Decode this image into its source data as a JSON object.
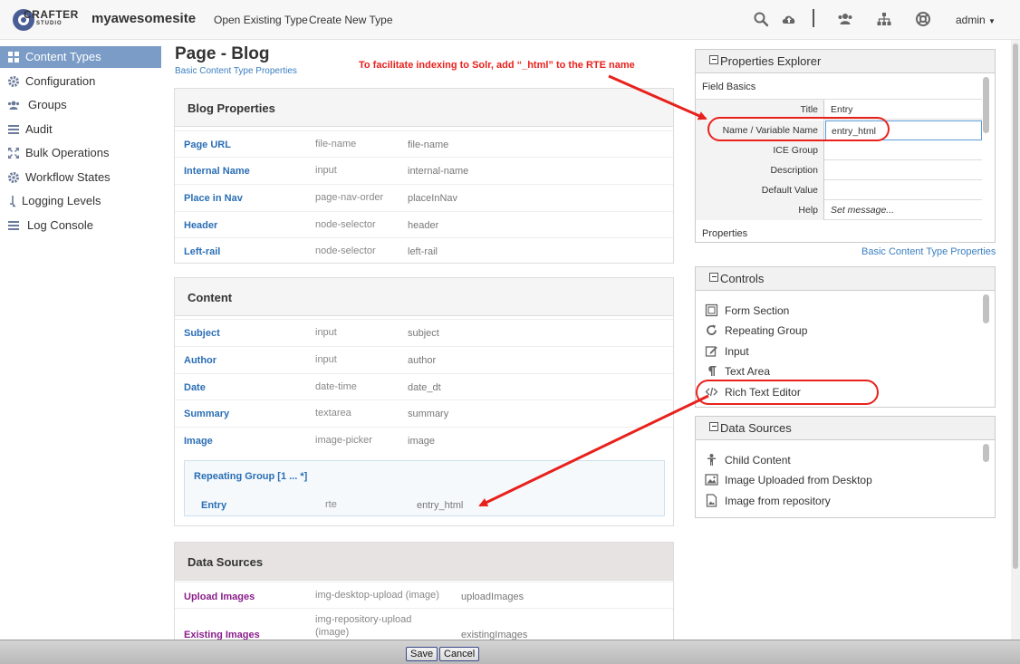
{
  "header": {
    "logo_text": "CRAFTER",
    "logo_sub": "STUDIO",
    "site_name": "myawesomesite",
    "nav": [
      "Open Existing Type",
      "Create New Type"
    ],
    "user": "admin"
  },
  "sidebar": {
    "items": [
      {
        "label": "Content Types",
        "icon": "grid-icon",
        "active": true
      },
      {
        "label": "Configuration",
        "icon": "gear-icon"
      },
      {
        "label": "Groups",
        "icon": "users-icon"
      },
      {
        "label": "Audit",
        "icon": "list-icon"
      },
      {
        "label": "Bulk Operations",
        "icon": "expand-icon"
      },
      {
        "label": "Workflow States",
        "icon": "gear-icon"
      },
      {
        "label": "Logging Levels",
        "icon": "level-icon"
      },
      {
        "label": "Log Console",
        "icon": "list-icon"
      }
    ]
  },
  "form": {
    "title": "Page - Blog",
    "subtitle": "Basic Content Type Properties",
    "annotation": "To facilitate indexing to Solr, add “_html” to the RTE name",
    "sections": [
      {
        "title": "Blog Properties",
        "rows": [
          {
            "label": "Page URL",
            "type": "file-name",
            "id": "file-name"
          },
          {
            "label": "Internal Name",
            "type": "input",
            "id": "internal-name"
          },
          {
            "label": "Place in Nav",
            "type": "page-nav-order",
            "id": "placeInNav"
          },
          {
            "label": "Header",
            "type": "node-selector",
            "id": "header"
          },
          {
            "label": "Left-rail",
            "type": "node-selector",
            "id": "left-rail"
          }
        ]
      },
      {
        "title": "Content",
        "rows": [
          {
            "label": "Subject",
            "type": "input",
            "id": "subject"
          },
          {
            "label": "Author",
            "type": "input",
            "id": "author"
          },
          {
            "label": "Date",
            "type": "date-time",
            "id": "date_dt"
          },
          {
            "label": "Summary",
            "type": "textarea",
            "id": "summary"
          },
          {
            "label": "Image",
            "type": "image-picker",
            "id": "image"
          }
        ],
        "repeating_group": {
          "title": "Repeating Group [1 ... *]",
          "rows": [
            {
              "label": "Entry",
              "type": "rte",
              "id": "entry_html"
            }
          ]
        }
      },
      {
        "title": "Data Sources",
        "rows": [
          {
            "label": "Upload Images",
            "type": "img-desktop-upload (image)",
            "id": "uploadImages"
          },
          {
            "label": "Existing Images",
            "type": "img-repository-upload (image)",
            "id": "existingImages"
          }
        ]
      }
    ]
  },
  "properties_explorer": {
    "title": "Properties Explorer",
    "group": "Field Basics",
    "rows": [
      {
        "key": "Title",
        "value": "Entry"
      },
      {
        "key": "Name / Variable Name",
        "value": "entry_html"
      },
      {
        "key": "ICE Group",
        "value": ""
      },
      {
        "key": "Description",
        "value": ""
      },
      {
        "key": "Default Value",
        "value": ""
      },
      {
        "key": "Help",
        "value": "Set message..."
      }
    ],
    "group2": "Properties",
    "link": "Basic Content Type Properties"
  },
  "controls": {
    "title": "Controls",
    "items": [
      {
        "label": "Form Section",
        "icon": "form-section-icon"
      },
      {
        "label": "Repeating Group",
        "icon": "repeat-icon"
      },
      {
        "label": "Input",
        "icon": "edit-icon"
      },
      {
        "label": "Text Area",
        "icon": "paragraph-icon"
      },
      {
        "label": "Rich Text Editor",
        "icon": "code-icon"
      }
    ]
  },
  "data_sources_panel": {
    "title": "Data Sources",
    "items": [
      {
        "label": "Child Content",
        "icon": "child-content-icon"
      },
      {
        "label": "Image Uploaded from Desktop",
        "icon": "image-icon"
      },
      {
        "label": "Image from repository",
        "icon": "image-file-icon"
      }
    ]
  },
  "footer": {
    "save": "Save",
    "cancel": "Cancel"
  },
  "colors": {
    "accent": "#7a9cc6",
    "link": "#2a6eb5",
    "annotation": "#e8211c",
    "datasource_link": "#8b1e8b"
  }
}
